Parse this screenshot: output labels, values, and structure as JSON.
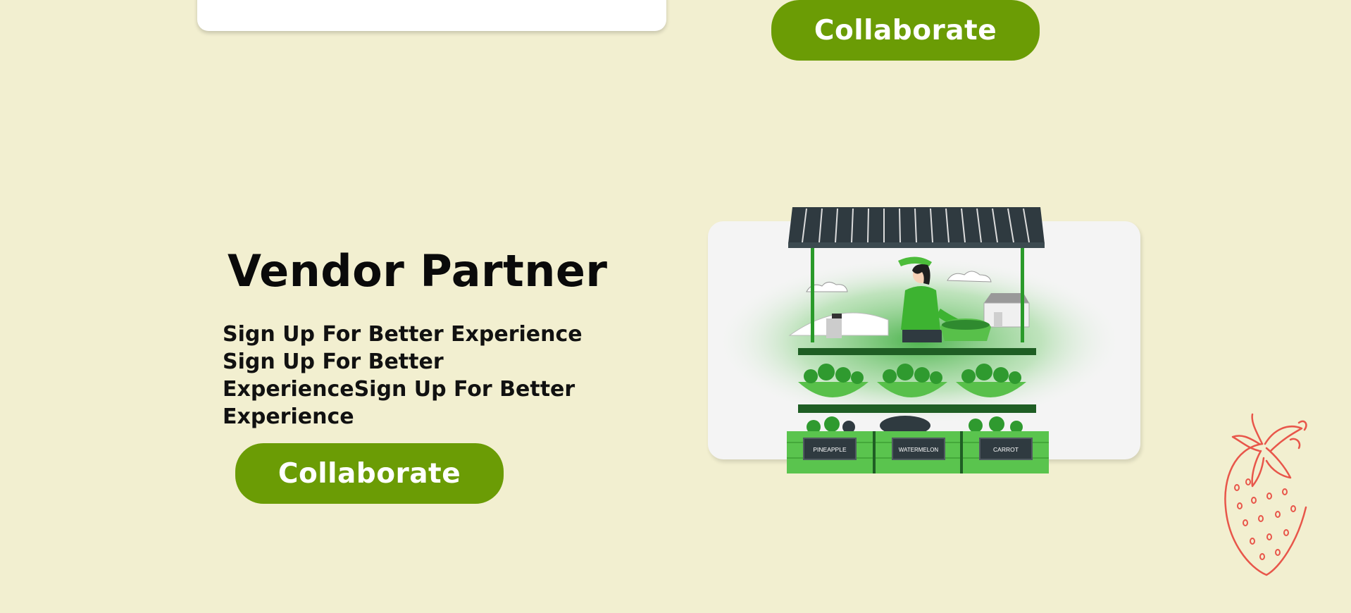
{
  "header": {
    "collaborate_label": "Collaborate"
  },
  "vendor": {
    "title": "Vendor Partner",
    "description": "Sign Up For Better Experience Sign Up For Better ExperienceSign Up For Better Experience",
    "collaborate_label": "Collaborate"
  },
  "illustration": {
    "labels": [
      "PINEAPPLE",
      "WATERMELON",
      "CARROT"
    ]
  },
  "colors": {
    "background": "#f2efd0",
    "accent": "#6b9c05",
    "stall_green": "#4cbc3a",
    "strawberry": "#e8564a"
  }
}
